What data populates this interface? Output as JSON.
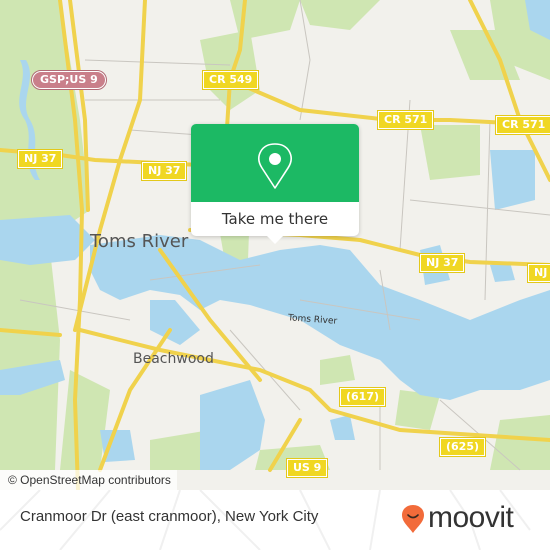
{
  "map": {
    "place_labels": {
      "toms_river_city": "Toms River",
      "beachwood": "Beachwood",
      "toms_river_water": "Toms River"
    },
    "road_shields": {
      "gsp_us9": "GSP;US 9",
      "cr549": "CR 549",
      "cr571_a": "CR 571",
      "cr571_b": "CR 571",
      "nj37_a": "NJ 37",
      "nj37_b": "NJ 37",
      "nj37_c": "NJ 37",
      "nj37_d": "NJ",
      "cr617": "(617)",
      "cr625": "(625)",
      "us9": "US 9"
    },
    "attribution": "© OpenStreetMap contributors",
    "colors": {
      "land": "#f2f1ec",
      "water": "#a9d8ef",
      "park": "#c8e4a8",
      "road": "#f6df6a",
      "popup_green": "#1cb964"
    }
  },
  "popup": {
    "icon": "location-pin-icon",
    "button_label": "Take me there"
  },
  "footer": {
    "title": "Cranmoor Dr (east cranmoor), New York City",
    "brand": "moovit",
    "brand_icon": "moovit-smiley-pin-icon",
    "brand_color": "#f26b3a"
  }
}
